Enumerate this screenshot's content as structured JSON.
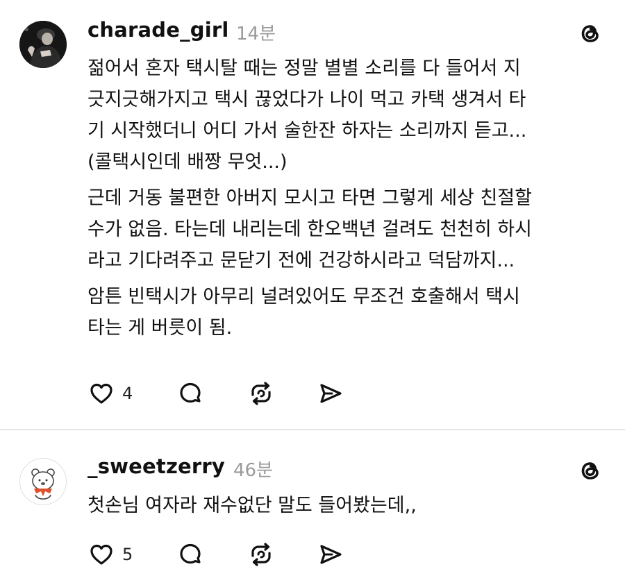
{
  "posts": [
    {
      "username": "charade_girl",
      "time": "14분",
      "avatar_icon": "user-photo-avatar",
      "paragraphs": [
        [
          "젊어서 혼자 택시탈 때는 정말 별별 소리를 다 들어서 지",
          "긋지긋해가지고 택시 끊었다가 나이 먹고 카택 생겨서 타",
          "기 시작했더니 어디 가서 술한잔 하자는 소리까지 듣고...",
          "(콜택시인데 배짱 무엇...)"
        ],
        [
          "근데 거동 불편한 아버지 모시고 타면 그렇게 세상 친절할",
          "수가 없음. 타는데 내리는데 한오백년 걸려도 천천히 하시",
          "라고 기다려주고 문닫기 전에 건강하시라고 덕담까지..."
        ],
        [
          "암튼 빈택시가 아무리 널려있어도 무조건 호출해서 택시",
          "타는 게 버릇이 됨."
        ]
      ],
      "like_count": "4"
    },
    {
      "username": "_sweetzerry",
      "time": "46분",
      "avatar_icon": "cartoon-bear-avatar",
      "paragraphs": [
        [
          "첫손님 여자라 재수없단 말도 들어봤는데,,"
        ]
      ],
      "like_count": "5"
    }
  ],
  "icons": {
    "brand": "threads-logo-icon",
    "like": "heart-icon",
    "comment": "comment-bubble-icon",
    "repost": "repost-icon",
    "share": "send-icon"
  },
  "colors": {
    "text": "#111111",
    "muted": "#9a9a9a",
    "divider": "#e4e4e4",
    "avatar_scarf": "#e0502a"
  }
}
